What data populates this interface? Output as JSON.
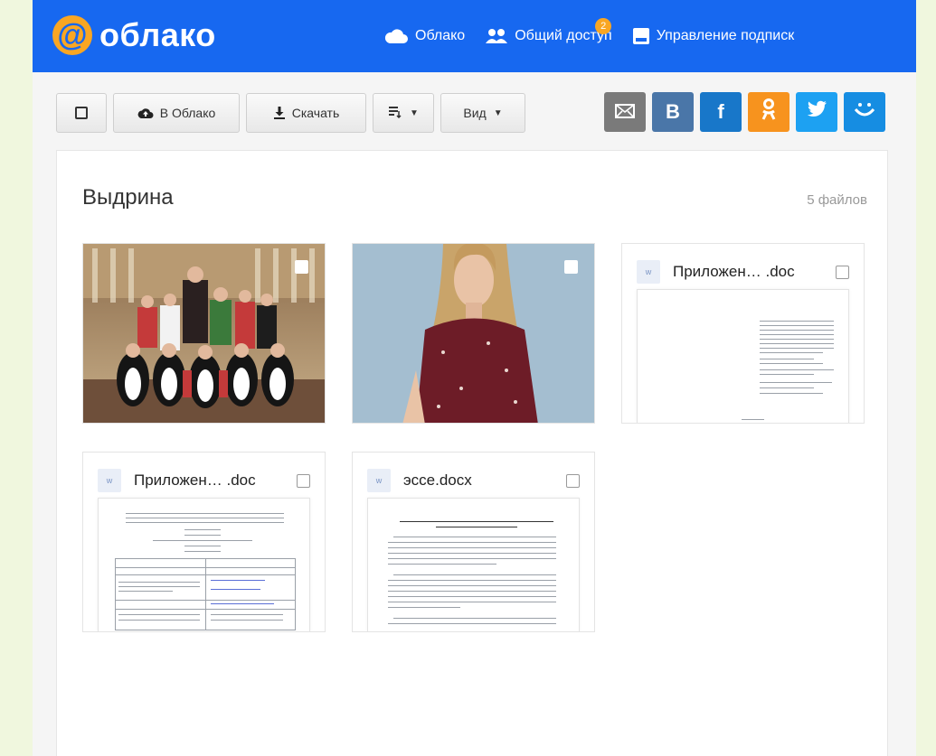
{
  "header": {
    "logo_symbol": "@",
    "logo_text": "облако",
    "nav": [
      {
        "label": "Облако",
        "icon": "cloud-icon"
      },
      {
        "label": "Общий доступ",
        "icon": "people-icon",
        "badge": "2"
      },
      {
        "label": "Управление подписк",
        "icon": "subscription-icon"
      }
    ]
  },
  "toolbar": {
    "to_cloud_label": "В Облако",
    "download_label": "Скачать",
    "sort_label": "",
    "view_label": "Вид"
  },
  "social": [
    {
      "name": "mail",
      "glyph": "✉",
      "color": "#7a7a7a"
    },
    {
      "name": "vk",
      "glyph": "B",
      "color": "#4a76a8"
    },
    {
      "name": "facebook",
      "glyph": "f",
      "color": "#1877c9"
    },
    {
      "name": "odnoklassniki",
      "glyph": "ꝏ",
      "color": "#f7931e"
    },
    {
      "name": "twitter",
      "glyph": "",
      "color": "#1da1f2"
    },
    {
      "name": "moimir",
      "glyph": "ᵔ‿ᵔ",
      "color": "#168de2"
    }
  ],
  "folder": {
    "title": "Выдрина",
    "file_count": "5 файлов"
  },
  "files": [
    {
      "type": "photo",
      "kind": "group-photo"
    },
    {
      "type": "photo",
      "kind": "portrait-photo"
    },
    {
      "type": "doc",
      "name": "Приложен… .doc"
    },
    {
      "type": "doc",
      "name": "Приложен… .doc"
    },
    {
      "type": "doc",
      "name": "эссе.docx"
    }
  ],
  "colors": {
    "brand_blue": "#1768f0",
    "brand_orange": "#f9a623"
  }
}
